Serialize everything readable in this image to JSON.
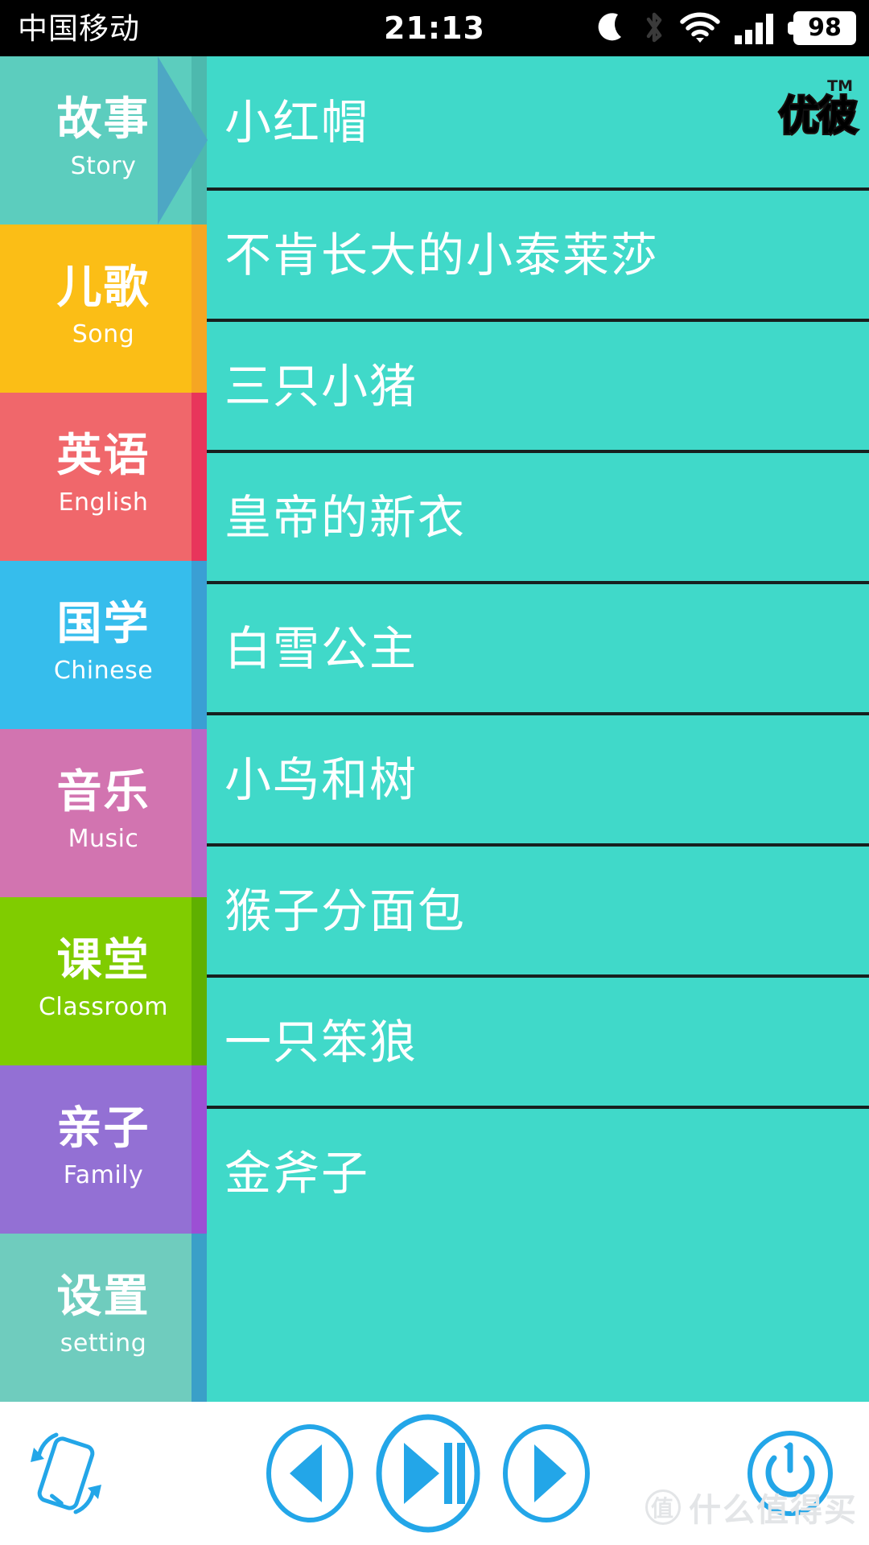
{
  "status_bar": {
    "carrier": "中国移动",
    "time": "21:13",
    "battery_level": "98",
    "icons": [
      "moon-icon",
      "bluetooth-icon",
      "wifi-icon",
      "signal-icon",
      "battery-icon"
    ]
  },
  "brand": {
    "logo_text": "优彼",
    "trademark": "TM"
  },
  "sidebar": {
    "items": [
      {
        "cn": "故事",
        "en": "Story",
        "bg": "#5CCDBE",
        "stripe": "#4DB9AE",
        "active": true
      },
      {
        "cn": "儿歌",
        "en": "Song",
        "bg": "#FBBE16",
        "stripe": "#F5A623",
        "active": false
      },
      {
        "cn": "英语",
        "en": "English",
        "bg": "#F0676B",
        "stripe": "#E8355B",
        "active": false
      },
      {
        "cn": "国学",
        "en": "Chinese",
        "bg": "#36BDEC",
        "stripe": "#3A9FD4",
        "active": false
      },
      {
        "cn": "音乐",
        "en": "Music",
        "bg": "#D274B0",
        "stripe": "#B867C6",
        "active": false
      },
      {
        "cn": "课堂",
        "en": "Classroom",
        "bg": "#80CC00",
        "stripe": "#5FB000",
        "active": false
      },
      {
        "cn": "亲子",
        "en": "Family",
        "bg": "#9370D4",
        "stripe": "#9C4FD4",
        "active": false
      },
      {
        "cn": "设置",
        "en": "setting",
        "bg": "#6FCCBE",
        "stripe": "#3AA0C8",
        "active": false
      }
    ]
  },
  "content": {
    "list": [
      {
        "title": "小红帽"
      },
      {
        "title": "不肯长大的小泰莱莎"
      },
      {
        "title": "三只小猪"
      },
      {
        "title": "皇帝的新衣"
      },
      {
        "title": "白雪公主"
      },
      {
        "title": "小鸟和树"
      },
      {
        "title": "猴子分面包"
      },
      {
        "title": "一只笨狼"
      },
      {
        "title": "金斧子"
      }
    ]
  },
  "bottom_bar": {
    "accent": "#23A6E8",
    "buttons": [
      {
        "name": "rotate-screen",
        "label": "rotate-screen-icon"
      },
      {
        "name": "previous",
        "label": "previous-icon"
      },
      {
        "name": "play-pause",
        "label": "play-pause-icon"
      },
      {
        "name": "next",
        "label": "next-icon"
      },
      {
        "name": "power",
        "label": "power-icon"
      }
    ]
  },
  "watermark": {
    "badge": "值",
    "text": "什么值得买"
  }
}
